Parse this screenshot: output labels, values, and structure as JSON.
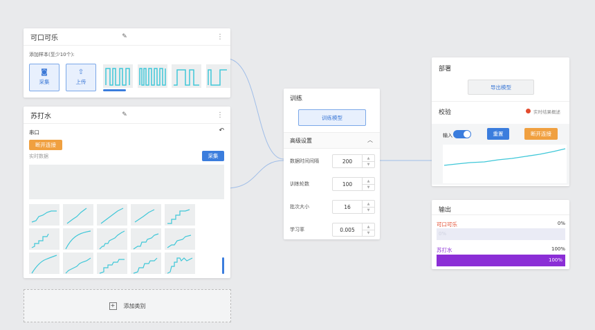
{
  "colors": {
    "accent": "#3b7ddd",
    "cyan": "#3ec7d8",
    "orange": "#f0a040",
    "purple": "#8b2ed6",
    "red": "#e34b2e"
  },
  "class1": {
    "title": "可口可乐",
    "add_samples": "添加样本(至少10个):",
    "capture": "采集",
    "upload": "上传"
  },
  "class2": {
    "title": "苏打水",
    "serial": "串口",
    "disconnect": "断开连接",
    "realtime": "实时数据",
    "capture": "采集"
  },
  "add_class": "添加类别",
  "train": {
    "title": "训练",
    "train_button": "训练模型",
    "advanced": "高级设置",
    "params": [
      {
        "label": "数据时间间隔",
        "value": "200"
      },
      {
        "label": "训练轮数",
        "value": "100"
      },
      {
        "label": "批次大小",
        "value": "16"
      },
      {
        "label": "学习率",
        "value": "0.005"
      }
    ]
  },
  "deploy": {
    "title": "部署",
    "export": "导出模型"
  },
  "verify": {
    "title": "校验",
    "live_label": "实时结果概述",
    "input_label": "输入",
    "reset": "重置",
    "disconnect": "断开连接"
  },
  "output": {
    "title": "输出",
    "items": [
      {
        "label": "可口可乐",
        "percent": "0%",
        "bar_text": "0%",
        "value": 0
      },
      {
        "label": "苏打水",
        "percent": "100%",
        "bar_text": "100%",
        "value": 100
      }
    ]
  }
}
